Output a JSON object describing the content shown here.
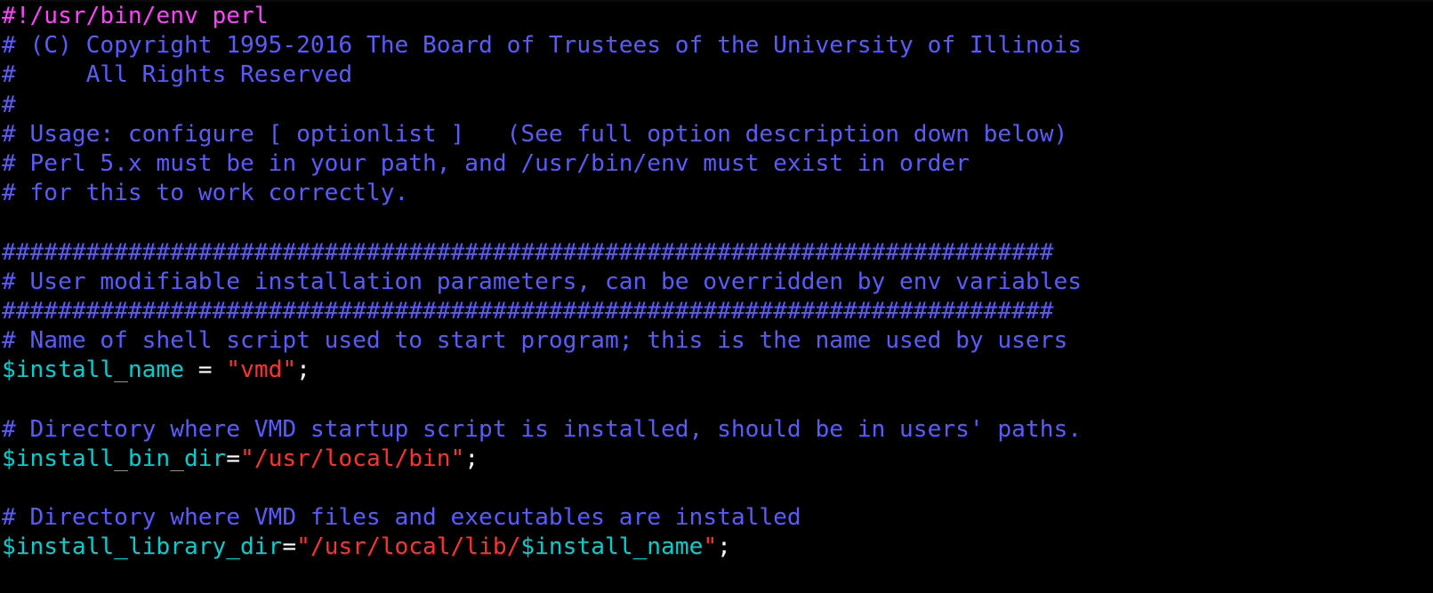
{
  "editor": {
    "colors": {
      "background": "#000000",
      "comment": "#5a5aff",
      "shebang": "#ff40ff",
      "variable": "#00d0d0",
      "operator": "#ffffff",
      "string": "#ff3030"
    },
    "lines": [
      [
        {
          "t": "shebang",
          "v": "#!/usr/bin/env perl"
        }
      ],
      [
        {
          "t": "comment",
          "v": "# (C) Copyright 1995-2016 The Board of Trustees of the University of Illinois"
        }
      ],
      [
        {
          "t": "comment",
          "v": "#     All Rights Reserved"
        }
      ],
      [
        {
          "t": "comment",
          "v": "#"
        }
      ],
      [
        {
          "t": "comment",
          "v": "# Usage: configure [ optionlist ]   (See full option description down below)"
        }
      ],
      [
        {
          "t": "comment",
          "v": "# Perl 5.x must be in your path, and /usr/bin/env must exist in order"
        }
      ],
      [
        {
          "t": "comment",
          "v": "# for this to work correctly."
        }
      ],
      [
        {
          "t": "blank",
          "v": ""
        }
      ],
      [
        {
          "t": "comment",
          "v": "###########################################################################"
        }
      ],
      [
        {
          "t": "comment",
          "v": "# User modifiable installation parameters, can be overridden by env variables"
        }
      ],
      [
        {
          "t": "comment",
          "v": "###########################################################################"
        }
      ],
      [
        {
          "t": "comment",
          "v": "# Name of shell script used to start program; this is the name used by users"
        }
      ],
      [
        {
          "t": "var",
          "v": "$install_name"
        },
        {
          "t": "op",
          "v": " = "
        },
        {
          "t": "string",
          "v": "\"vmd\""
        },
        {
          "t": "punct",
          "v": ";"
        }
      ],
      [
        {
          "t": "blank",
          "v": ""
        }
      ],
      [
        {
          "t": "comment",
          "v": "# Directory where VMD startup script is installed, should be in users' paths."
        }
      ],
      [
        {
          "t": "var",
          "v": "$install_bin_dir"
        },
        {
          "t": "op",
          "v": "="
        },
        {
          "t": "string",
          "v": "\"/usr/local/bin\""
        },
        {
          "t": "punct",
          "v": ";"
        }
      ],
      [
        {
          "t": "blank",
          "v": ""
        }
      ],
      [
        {
          "t": "comment",
          "v": "# Directory where VMD files and executables are installed"
        }
      ],
      [
        {
          "t": "var",
          "v": "$install_library_dir"
        },
        {
          "t": "op",
          "v": "="
        },
        {
          "t": "string",
          "v": "\"/usr/local/lib/"
        },
        {
          "t": "var",
          "v": "$install_name"
        },
        {
          "t": "string",
          "v": "\""
        },
        {
          "t": "punct",
          "v": ";"
        }
      ]
    ]
  }
}
